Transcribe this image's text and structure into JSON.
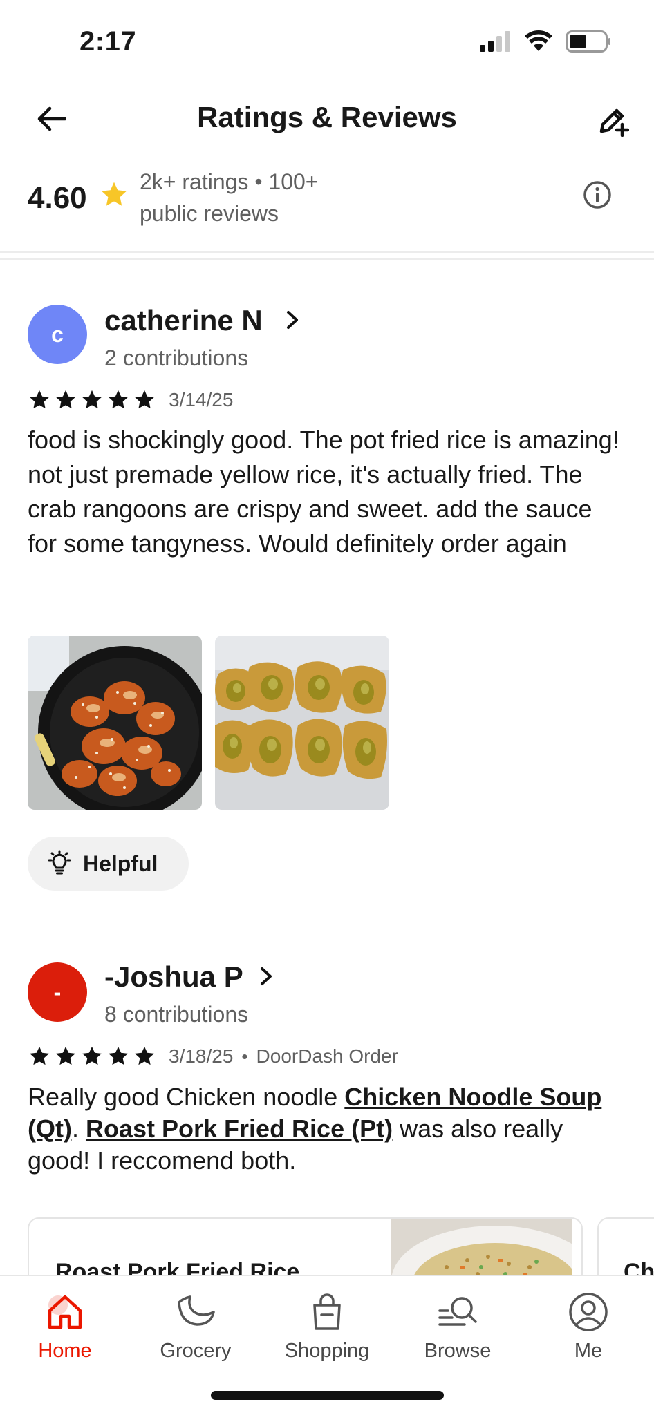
{
  "status_bar": {
    "time": "2:17"
  },
  "header": {
    "title": "Ratings & Reviews"
  },
  "summary": {
    "score": "4.60",
    "counts_line1": "2k+ ratings • 100+",
    "counts_line2": "public reviews"
  },
  "reviews": [
    {
      "initial": "c",
      "avatar_color": "#6f86f7",
      "name": "catherine N",
      "contributions": "2 contributions",
      "stars": 5,
      "date": "3/14/25",
      "text": "food is shockingly good. The pot fried rice is amazing! not just premade yellow rice, it's actually fried. The crab rangoons are crispy and sweet. add the sauce for some tangyness. Would definitely order again",
      "photos": [
        "sesame-chicken-photo",
        "crab-rangoon-photo"
      ],
      "helpful_label": "Helpful"
    },
    {
      "initial": "-",
      "avatar_color": "#db1e0b",
      "name": "-Joshua P",
      "contributions": "8 contributions",
      "stars": 5,
      "date": "3/18/25",
      "source": "DoorDash Order",
      "text_part1": "Really good Chicken noodle ",
      "link1": "Chicken Noodle Soup (Qt)",
      "text_part2": ". ",
      "link2": "Roast Pork Fried Rice (Pt)",
      "text_part3": " was also really good! I reccomend both."
    }
  ],
  "item_cards": [
    {
      "title": "Roast Pork Fried Rice"
    },
    {
      "title": "Ch"
    }
  ],
  "tabs": [
    {
      "label": "Home",
      "icon": "home-icon",
      "active": true
    },
    {
      "label": "Grocery",
      "icon": "grocery-icon",
      "active": false
    },
    {
      "label": "Shopping",
      "icon": "shopping-bag-icon",
      "active": false
    },
    {
      "label": "Browse",
      "icon": "browse-search-icon",
      "active": false
    },
    {
      "label": "Me",
      "icon": "profile-icon",
      "active": false
    }
  ],
  "colors": {
    "brand_red": "#eb1700",
    "star_yellow": "#f7c628",
    "text_secondary": "#606060"
  }
}
